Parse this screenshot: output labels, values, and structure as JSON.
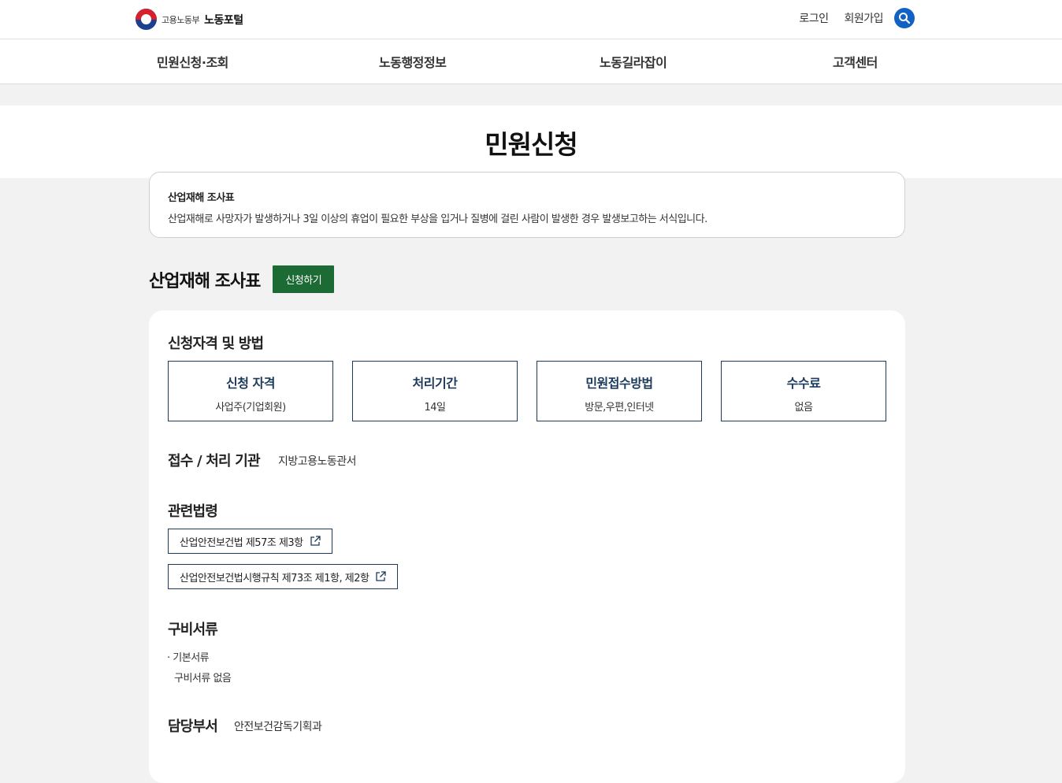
{
  "header": {
    "ministry": "고용노동부",
    "portal": "노동포털",
    "login": "로그인",
    "signup": "회원가입",
    "search_icon": "search-icon"
  },
  "gnb": [
    "민원신청·조회",
    "노동행정정보",
    "노동길라잡이",
    "고객센터"
  ],
  "page_title": "민원신청",
  "summary": {
    "title": "산업재해 조사표",
    "desc": "산업재해로 사망자가 발생하거나 3일 이상의 휴업이 필요한 부상을 입거나 질병에 걸린 사람이 발생한 경우 발생보고하는 서식입니다."
  },
  "section": {
    "title": "산업재해 조사표",
    "apply": "신청하기"
  },
  "qualification": {
    "heading": "신청자격 및 방법",
    "items": [
      {
        "label": "신청 자격",
        "value": "사업주(기업회원)"
      },
      {
        "label": "처리기간",
        "value": "14일"
      },
      {
        "label": "민원접수방법",
        "value": "방문,우편,인터넷"
      },
      {
        "label": "수수료",
        "value": "없음"
      }
    ]
  },
  "agency": {
    "label": "접수 / 처리 기관",
    "value": "지방고용노동관서"
  },
  "laws": {
    "heading": "관련법령",
    "items": [
      "산업안전보건법 제57조 제3항",
      "산업안전보건법시행규칙 제73조 제1항, 제2항"
    ]
  },
  "documents": {
    "heading": "구비서류",
    "bullet": "기본서류",
    "detail": "구비서류 없음"
  },
  "department": {
    "label": "담당부서",
    "value": "안전보건감독기획과"
  },
  "colors": {
    "primary_navy": "#1b3a5c",
    "apply_green": "#1d6b34",
    "search_blue": "#1262c5"
  }
}
